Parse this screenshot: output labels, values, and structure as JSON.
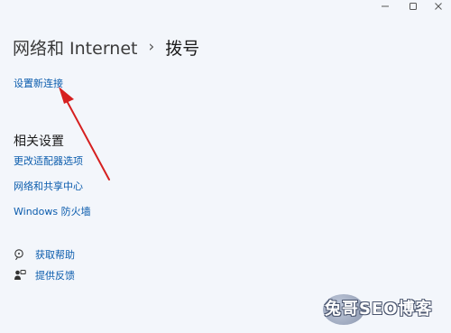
{
  "window": {
    "minimize_icon": "minimize-icon",
    "maximize_icon": "maximize-icon",
    "close_icon": "close-icon"
  },
  "breadcrumb": {
    "parent": "网络和 Internet",
    "separator": "›",
    "current": "拨号"
  },
  "main": {
    "setup_link": "设置新连接"
  },
  "related": {
    "title": "相关设置",
    "links": [
      "更改适配器选项",
      "网络和共享中心",
      "Windows 防火墙"
    ]
  },
  "help": {
    "get_help": "获取帮助",
    "feedback": "提供反馈"
  },
  "colors": {
    "background": "#f3f6fb",
    "link": "#0b5cad",
    "annotation_arrow": "#d62020"
  },
  "watermark": {
    "text": "兔哥SEO博客"
  }
}
